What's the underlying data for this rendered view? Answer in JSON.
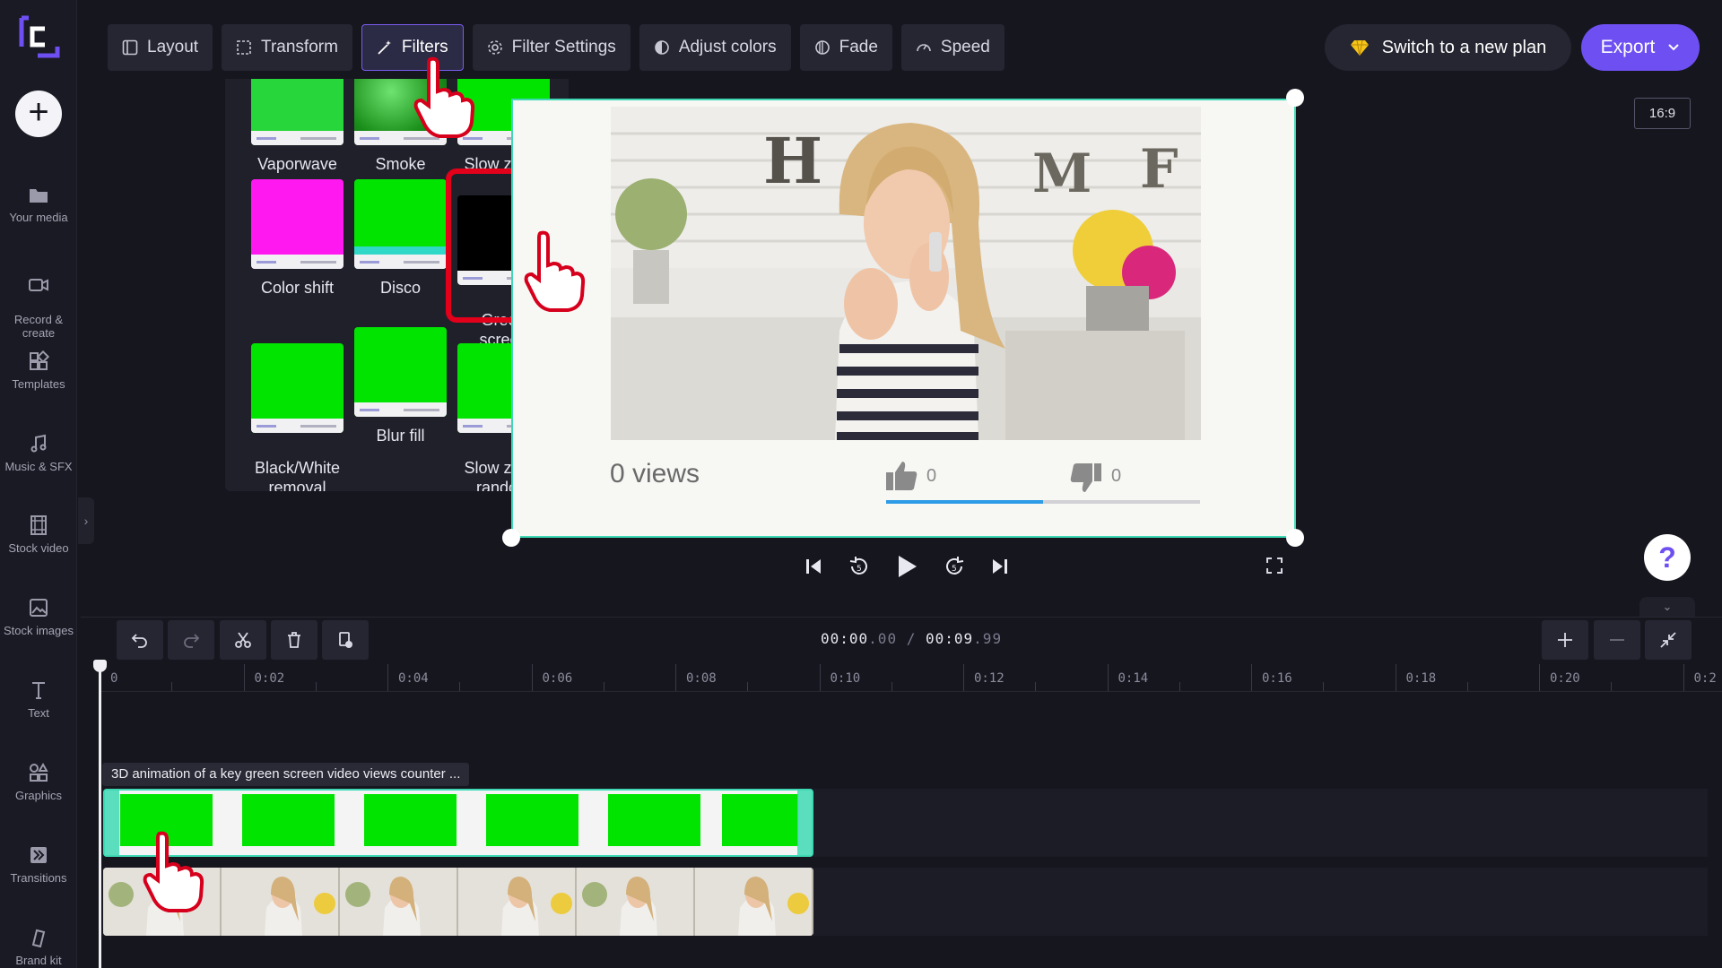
{
  "sidebar": {
    "add_label": "+",
    "items": [
      {
        "label": "Your media"
      },
      {
        "label": "Record &\ncreate"
      },
      {
        "label": "Templates"
      },
      {
        "label": "Music & SFX"
      },
      {
        "label": "Stock video"
      },
      {
        "label": "Stock images"
      },
      {
        "label": "Text"
      },
      {
        "label": "Graphics"
      },
      {
        "label": "Transitions"
      },
      {
        "label": "Brand kit"
      }
    ],
    "collapse_glyph": "›"
  },
  "toolbar": {
    "tabs": [
      {
        "label": "Layout"
      },
      {
        "label": "Transform"
      },
      {
        "label": "Filters",
        "active": true
      },
      {
        "label": "Filter Settings"
      },
      {
        "label": "Adjust colors"
      },
      {
        "label": "Fade"
      },
      {
        "label": "Speed"
      }
    ],
    "switch_plan_label": "Switch to a new plan",
    "export_label": "Export"
  },
  "aspect_ratio": "16:9",
  "filters": {
    "items": [
      {
        "label": "Vaporwave",
        "color": "#27d63a"
      },
      {
        "label": "Smoke",
        "color": "#1a8f1a"
      },
      {
        "label": "Slow zoom",
        "color": "#00e400"
      },
      {
        "label": "Color shift",
        "color": "#ff19f0"
      },
      {
        "label": "Disco",
        "color": "#00e400"
      },
      {
        "label": "Green\nscreen",
        "color": "#000000",
        "selected": true
      },
      {
        "label": "Black/White\nremoval",
        "color": "#00e400"
      },
      {
        "label": "Blur fill",
        "color": "#00e400"
      },
      {
        "label": "Slow zoom\nrandom",
        "color": "#00e400"
      }
    ]
  },
  "preview": {
    "views_text": "0 views",
    "likes": "0",
    "dislikes": "0",
    "progress": 0.5,
    "wall_letters": [
      "H",
      "M",
      "F"
    ]
  },
  "timeline": {
    "current_time": "00:00",
    "current_frac": ".00",
    "separator": "/",
    "total_time": "00:09",
    "total_frac": ".99",
    "ruler_labels": [
      "0",
      "0:02",
      "0:04",
      "0:06",
      "0:08",
      "0:10",
      "0:12",
      "0:14",
      "0:16",
      "0:18",
      "0:20",
      "0:2"
    ],
    "clip_title": "3D animation of a key green screen video views counter ..."
  },
  "help_label": "?",
  "colors": {
    "accent": "#6e4ff2",
    "selection": "#3ed9b4",
    "highlight": "#e3001b",
    "chroma_green": "#00e400"
  }
}
